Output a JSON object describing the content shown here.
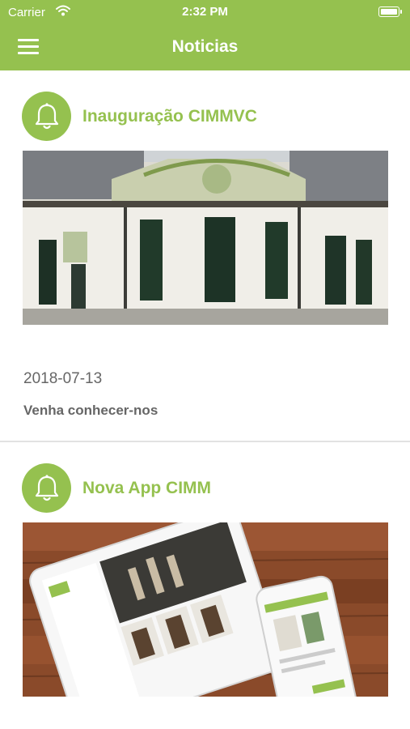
{
  "status_bar": {
    "carrier": "Carrier",
    "time": "2:32 PM"
  },
  "nav_bar": {
    "title": "Noticias"
  },
  "posts": [
    {
      "title": "Inauguração CIMMVC",
      "date": "2018-07-13",
      "summary": "Venha conhecer-nos"
    },
    {
      "title": "Nova App CIMM"
    }
  ],
  "colors": {
    "accent": "#95c14f"
  },
  "icons": {
    "menu": "hamburger-menu-icon",
    "post": "bell-icon"
  }
}
